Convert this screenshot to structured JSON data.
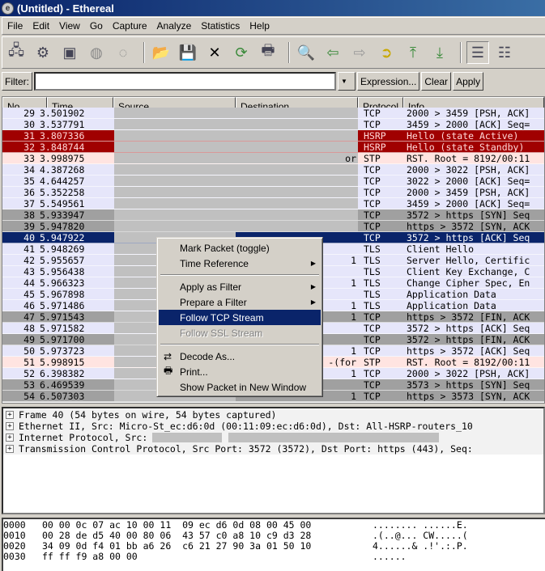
{
  "window": {
    "title": "(Untitled) - Ethereal"
  },
  "menubar": [
    "File",
    "Edit",
    "View",
    "Go",
    "Capture",
    "Analyze",
    "Statistics",
    "Help"
  ],
  "toolbar": [
    "interfaces-icon",
    "options-icon",
    "start-capture-icon",
    "stop-capture-icon",
    "restart-capture-icon",
    "open-icon",
    "save-icon",
    "close-icon",
    "reload-icon",
    "print-icon",
    "find-icon",
    "back-icon",
    "forward-icon",
    "go-to-packet-icon",
    "first-packet-icon",
    "last-packet-icon",
    "colorize-icon",
    "autoscroll-icon"
  ],
  "filter": {
    "label": "Filter:",
    "value": "",
    "expression": "Expression...",
    "clear": "Clear",
    "apply": "Apply"
  },
  "columns": [
    "No. .",
    "Time",
    "Source",
    "Destination",
    "Protocol",
    "Info"
  ],
  "colors": {
    "normal": "#e6e6fa",
    "hsrp": "#a00000",
    "stp": "#ffe4e1",
    "gray": "#a0a0a0",
    "selected": "#0a246a"
  },
  "packets": [
    {
      "no": "29",
      "time": "3.501902",
      "dst": "",
      "proto": "TCP",
      "info": "2000 > 3459 [PSH, ACK]",
      "style": "normal"
    },
    {
      "no": "30",
      "time": "3.537791",
      "dst": "",
      "proto": "TCP",
      "info": "3459 > 2000 [ACK] Seq=",
      "style": "normal"
    },
    {
      "no": "31",
      "time": "3.807336",
      "dst": "",
      "proto": "HSRP",
      "info": "Hello (state Active)",
      "style": "hsrp"
    },
    {
      "no": "32",
      "time": "3.848744",
      "dst": "",
      "proto": "HSRP",
      "info": "Hello (state Standby)",
      "style": "hsrp"
    },
    {
      "no": "33",
      "time": "3.998975",
      "dst": "or",
      "proto": "STP",
      "info": "RST. Root = 8192/00:11",
      "style": "stp"
    },
    {
      "no": "34",
      "time": "4.387268",
      "dst": "",
      "proto": "TCP",
      "info": "2000 > 3022 [PSH, ACK]",
      "style": "normal"
    },
    {
      "no": "35",
      "time": "4.644257",
      "dst": "",
      "proto": "TCP",
      "info": "3022 > 2000 [ACK] Seq=",
      "style": "normal"
    },
    {
      "no": "36",
      "time": "5.352258",
      "dst": "",
      "proto": "TCP",
      "info": "2000 > 3459 [PSH, ACK]",
      "style": "normal"
    },
    {
      "no": "37",
      "time": "5.549561",
      "dst": "",
      "proto": "TCP",
      "info": "3459 > 2000 [ACK] Seq=",
      "style": "normal"
    },
    {
      "no": "38",
      "time": "5.933947",
      "dst": "",
      "proto": "TCP",
      "info": "3572 > https [SYN] Seq",
      "style": "gray"
    },
    {
      "no": "39",
      "time": "5.947820",
      "dst": "",
      "proto": "TCP",
      "info": "https > 3572 [SYN, ACK",
      "style": "gray"
    },
    {
      "no": "40",
      "time": "5.947922",
      "dst": "",
      "proto": "TCP",
      "info": "3572 > https [ACK] Seq",
      "style": "sel"
    },
    {
      "no": "41",
      "time": "5.948269",
      "dst": "",
      "proto": "TLS",
      "info": "Client Hello",
      "style": "normal"
    },
    {
      "no": "42",
      "time": "5.955657",
      "dst": "1",
      "proto": "TLS",
      "info": "Server Hello, Certific",
      "style": "normal"
    },
    {
      "no": "43",
      "time": "5.956438",
      "dst": "",
      "proto": "TLS",
      "info": "Client Key Exchange, C",
      "style": "normal"
    },
    {
      "no": "44",
      "time": "5.966323",
      "dst": "1",
      "proto": "TLS",
      "info": "Change Cipher Spec, En",
      "style": "normal"
    },
    {
      "no": "45",
      "time": "5.967898",
      "dst": "",
      "proto": "TLS",
      "info": "Application Data",
      "style": "normal"
    },
    {
      "no": "46",
      "time": "5.971486",
      "dst": "1",
      "proto": "TLS",
      "info": "Application Data",
      "style": "normal"
    },
    {
      "no": "47",
      "time": "5.971543",
      "dst": "1",
      "proto": "TCP",
      "info": "https > 3572 [FIN, ACK",
      "style": "gray"
    },
    {
      "no": "48",
      "time": "5.971582",
      "dst": "",
      "proto": "TCP",
      "info": "3572 > https [ACK] Seq",
      "style": "normal"
    },
    {
      "no": "49",
      "time": "5.971700",
      "dst": "",
      "proto": "TCP",
      "info": "3572 > https [FIN, ACK",
      "style": "gray"
    },
    {
      "no": "50",
      "time": "5.973723",
      "dst": "1",
      "proto": "TCP",
      "info": "https > 3572 [ACK] Seq",
      "style": "normal"
    },
    {
      "no": "51",
      "time": "5.998915",
      "dst": "-(for",
      "proto": "STP",
      "info": "RST. Root = 8192/00:11",
      "style": "stp"
    },
    {
      "no": "52",
      "time": "6.398382",
      "dst": "1",
      "proto": "TCP",
      "info": "2000 > 3022 [PSH, ACK]",
      "style": "normal"
    },
    {
      "no": "53",
      "time": "6.469539",
      "dst": "",
      "proto": "TCP",
      "info": "3573 > https [SYN] Seq",
      "style": "gray"
    },
    {
      "no": "54",
      "time": "6.507303",
      "dst": "1",
      "proto": "TCP",
      "info": "https > 3573 [SYN, ACK",
      "style": "gray"
    }
  ],
  "context_menu": [
    {
      "label": "Mark Packet (toggle)"
    },
    {
      "label": "Time Reference",
      "submenu": true
    },
    {
      "sep": true
    },
    {
      "label": "Apply as Filter",
      "submenu": true
    },
    {
      "label": "Prepare a Filter",
      "submenu": true
    },
    {
      "label": "Follow TCP Stream",
      "highlighted": true
    },
    {
      "label": "Follow SSL Stream",
      "disabled": true
    },
    {
      "sep": true
    },
    {
      "label": "Decode As...",
      "icon": "decode-icon"
    },
    {
      "label": "Print...",
      "icon": "print-icon"
    },
    {
      "label": "Show Packet in New Window"
    }
  ],
  "details": [
    "Frame 40 (54 bytes on wire, 54 bytes captured)",
    "Ethernet II, Src: Micro-St_ec:d6:0d (00:11:09:ec:d6:0d), Dst: All-HSRP-routers_10",
    "Internet Protocol, Src:",
    "Transmission Control Protocol, Src Port: 3572 (3572), Dst Port: https (443), Seq:"
  ],
  "hex": [
    {
      "offset": "0000",
      "bytes": "00 00 0c 07 ac 10 00 11  09 ec d6 0d 08 00 45 00",
      "ascii": "........ ......E."
    },
    {
      "offset": "0010",
      "bytes": "00 28 de d5 40 00 80 06  43 57 c0 a8 10 c9 d3 28",
      "ascii": ".(..@... CW.....("
    },
    {
      "offset": "0020",
      "bytes": "34 09 0d f4 01 bb a6 26  c6 21 27 90 3a 01 50 10",
      "ascii": "4......& .!'.:.P."
    },
    {
      "offset": "0030",
      "bytes": "ff ff f9 a8 00 00",
      "ascii": "......"
    }
  ]
}
